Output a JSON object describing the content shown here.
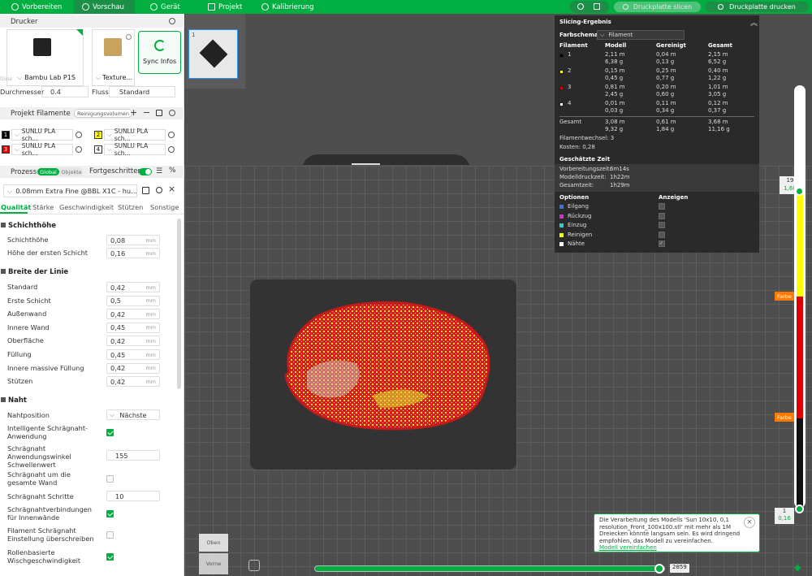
{
  "topbar": {
    "tabs": [
      "Vorbereiten",
      "Vorschau",
      "Gerät",
      "Projekt",
      "Kalibrierung"
    ],
    "slice_button": "Druckplatte slicen",
    "print_button": "Druckplatte drucken"
  },
  "printer": {
    "section": "Drucker",
    "name": "Bambu Lab P1S",
    "plate": "Texture...",
    "sync": "Sync Infos",
    "nozzle_label": "Durchmesser",
    "nozzle_value": "0.4",
    "flow_label": "Fluss",
    "flow_value": "Standard",
    "dim_label": "Düse"
  },
  "filaments": {
    "section": "Projekt Filamente",
    "cleaning": "Reinigungsvolumen",
    "items": [
      {
        "num": "1",
        "name": "SUNLU PLA sch...",
        "color": "#000000",
        "text": "#ffffff"
      },
      {
        "num": "2",
        "name": "SUNLU PLA sch...",
        "color": "#ffff00",
        "text": "#000000"
      },
      {
        "num": "3",
        "name": "SUNLU PLA sch...",
        "color": "#e00000",
        "text": "#ffffff"
      },
      {
        "num": "4",
        "name": "SUNLU PLA sch...",
        "color": "#ffffff",
        "text": "#000000"
      }
    ]
  },
  "process": {
    "section": "Prozess",
    "global": "Global",
    "objects": "Objekte",
    "advanced": "Fortgeschritten",
    "preset": "0.08mm Extra Fine @BBL X1C - hu...",
    "tabs": [
      "Qualität",
      "Stärke",
      "Geschwindigkeit",
      "Stützen",
      "Sonstige"
    ]
  },
  "quality": {
    "layer_group": "Schichthöhe",
    "layer": [
      {
        "label": "Schichthöhe",
        "value": "0,08",
        "unit": "mm"
      },
      {
        "label": "Höhe der ersten Schicht",
        "value": "0,16",
        "unit": "mm"
      }
    ],
    "width_group": "Breite der Linie",
    "widths": [
      {
        "label": "Standard",
        "value": "0,42",
        "unit": "mm"
      },
      {
        "label": "Erste Schicht",
        "value": "0,5",
        "unit": "mm"
      },
      {
        "label": "Außenwand",
        "value": "0,42",
        "unit": "mm"
      },
      {
        "label": "Innere Wand",
        "value": "0,45",
        "unit": "mm"
      },
      {
        "label": "Oberfläche",
        "value": "0,42",
        "unit": "mm"
      },
      {
        "label": "Füllung",
        "value": "0,45",
        "unit": "mm"
      },
      {
        "label": "Innere massive Füllung",
        "value": "0,42",
        "unit": "mm"
      },
      {
        "label": "Stützen",
        "value": "0,42",
        "unit": "mm"
      }
    ],
    "seam_group": "Naht",
    "seam_position_label": "Nahtposition",
    "seam_position_value": "Nächste",
    "smart_scarf_label": "Intelligente Schrägnaht-Anwendung",
    "scarf_angle_label": "Schrägnaht Anwendungswinkel Schwellenwert",
    "scarf_angle_value": "155",
    "scarf_entire_label": "Schrägnaht um die gesamte Wand",
    "scarf_steps_label": "Schrägnaht Schritte",
    "scarf_steps_value": "10",
    "scarf_inner_label": "Schrägnahtverbindungen für Innenwände",
    "override_label": "Filament Schrägnaht Einstellung überschreiben",
    "role_speed_label": "Rollenbasierte Wischgeschwindigkeit"
  },
  "slicing": {
    "title": "Slicing-Ergebnis",
    "scheme_label": "Farbschema",
    "scheme_value": "Filament",
    "cols": [
      "Filament",
      "Modell",
      "Gereinigt",
      "Gesamt"
    ],
    "rows": [
      {
        "n": "1",
        "color": "#000000",
        "m": [
          "2,11 m",
          "6,38 g"
        ],
        "g": [
          "0,04 m",
          "0,13 g"
        ],
        "t": [
          "2,15 m",
          "6,52 g"
        ]
      },
      {
        "n": "2",
        "color": "#ffff00",
        "m": [
          "0,15 m",
          "0,45 g"
        ],
        "g": [
          "0,25 m",
          "0,77 g"
        ],
        "t": [
          "0,40 m",
          "1,22 g"
        ]
      },
      {
        "n": "3",
        "color": "#e00000",
        "m": [
          "0,81 m",
          "2,45 g"
        ],
        "g": [
          "0,20 m",
          "0,60 g"
        ],
        "t": [
          "1,01 m",
          "3,05 g"
        ]
      },
      {
        "n": "4",
        "color": "#ffffff",
        "m": [
          "0,01 m",
          "0,03 g"
        ],
        "g": [
          "0,11 m",
          "0,34 g"
        ],
        "t": [
          "0,12 m",
          "0,37 g"
        ]
      }
    ],
    "total_label": "Gesamt",
    "total": {
      "m": [
        "3,08 m",
        "9,32 g"
      ],
      "g": [
        "0,61 m",
        "1,84 g"
      ],
      "t": [
        "3,68 m",
        "11,16 g"
      ]
    },
    "changes": "Filamentwechsel:  3",
    "cost": "Kosten:  0,28",
    "time_title": "Geschätzte Zeit",
    "times": [
      {
        "l": "Vorbereitungszeit:",
        "v": "6m14s"
      },
      {
        "l": "Modelldruckzeit:",
        "v": "1h22m"
      },
      {
        "l": "Gesamtzeit:",
        "v": "1h29m"
      }
    ],
    "opt_title": "Optionen",
    "show_title": "Anzeigen",
    "options": [
      {
        "l": "Eilgang",
        "c": "#3c6edc",
        "on": false
      },
      {
        "l": "Rückzug",
        "c": "#cc33cc",
        "on": false
      },
      {
        "l": "Einzug",
        "c": "#33cccc",
        "on": false
      },
      {
        "l": "Reinigen",
        "c": "#ffff00",
        "on": false
      },
      {
        "l": "Nähte",
        "c": "#ffffff",
        "on": true
      }
    ]
  },
  "plate": {
    "number": "1"
  },
  "layer_slider": {
    "top_layer": "19",
    "top_height": "1,60",
    "bottom_layer": "1",
    "bottom_height": "0,16",
    "color_tags": [
      "Farbe",
      "Farbe"
    ],
    "top_fraction": 0.05
  },
  "move_slider": {
    "value": "2859",
    "fraction": 1.0
  },
  "viewcube": {
    "top": "Oben",
    "front": "Vorne"
  },
  "notification": {
    "text": "Die Verarbeitung des Modells 'Sun 10x10, 0,1 resolution_Front_100x100.stl' mit mehr als 1M Dreiecken könnte langsam sein. Es wird dringend empfohlen, das Modell zu vereinfachen.",
    "link": "Modell vereinfachen"
  },
  "colors": {
    "accent": "#00ae42",
    "accent_dark": "#1c8f47",
    "orange": "#ff7a00"
  }
}
